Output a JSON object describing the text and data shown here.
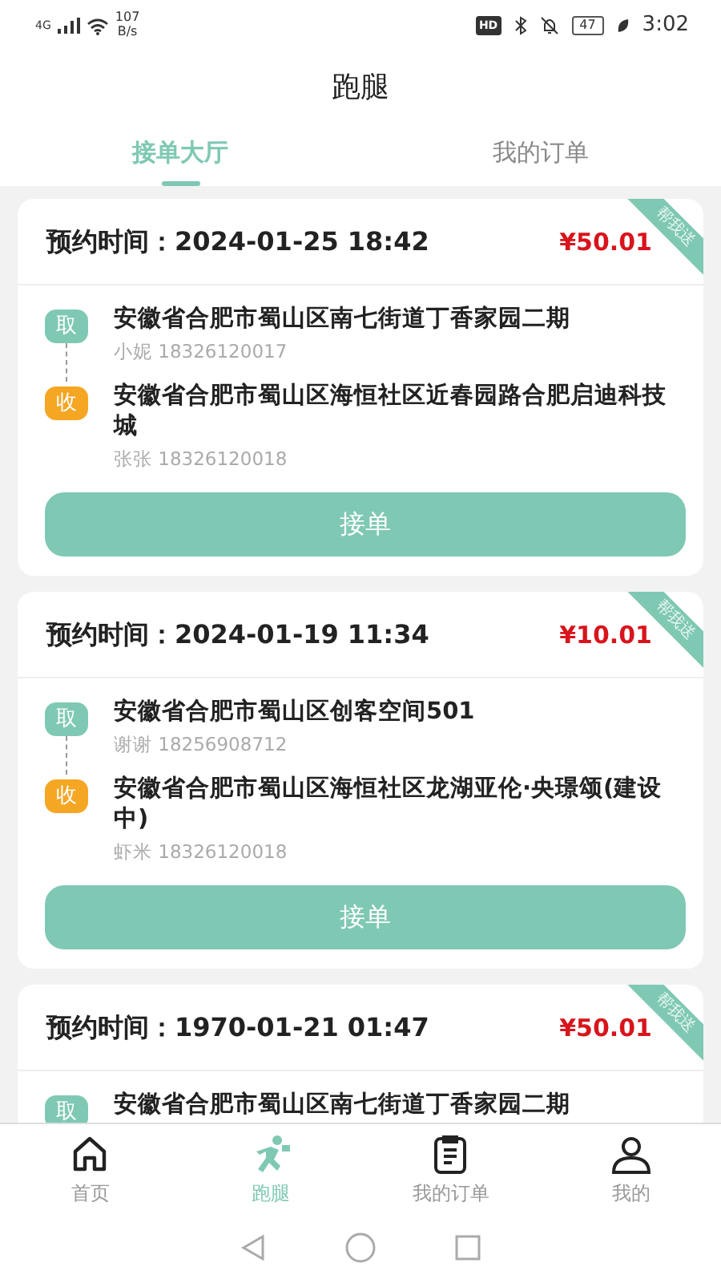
{
  "status_bar": {
    "network": "4G",
    "speed": "107",
    "speed_unit": "B/s",
    "hd": "HD",
    "battery": "47",
    "time": "3:02"
  },
  "title": "跑腿",
  "tabs": [
    {
      "label": "接单大厅",
      "selected": true
    },
    {
      "label": "我的订单",
      "selected": false
    }
  ],
  "orders": [
    {
      "time_label": "预约时间：",
      "time": "2024-01-25 18:42",
      "price": "¥50.01",
      "ribbon": "帮我送",
      "stops": [
        {
          "kind": "pickup",
          "badge": "取",
          "address": "安徽省合肥市蜀山区南七街道丁香家园二期",
          "contact": "小妮 18326120017"
        },
        {
          "kind": "dropoff",
          "badge": "收",
          "address": "安徽省合肥市蜀山区海恒社区近春园路合肥启迪科技城",
          "contact": "张张 18326120018"
        }
      ],
      "button": "接单"
    },
    {
      "time_label": "预约时间：",
      "time": "2024-01-19 11:34",
      "price": "¥10.01",
      "ribbon": "帮我送",
      "stops": [
        {
          "kind": "pickup",
          "badge": "取",
          "address": "安徽省合肥市蜀山区创客空间501",
          "contact": "谢谢 18256908712"
        },
        {
          "kind": "dropoff",
          "badge": "收",
          "address": "安徽省合肥市蜀山区海恒社区龙湖亚伦·央璟颂(建设中)",
          "contact": "虾米 18326120018"
        }
      ],
      "button": "接单"
    },
    {
      "time_label": "预约时间：",
      "time": "1970-01-21 01:47",
      "price": "¥50.01",
      "ribbon": "帮我送",
      "stops": [
        {
          "kind": "pickup",
          "badge": "取",
          "address": "安徽省合肥市蜀山区南七街道丁香家园二期"
        }
      ]
    }
  ],
  "bottom_nav": [
    {
      "kind": "home",
      "label": "首页",
      "selected": false
    },
    {
      "kind": "runner",
      "label": "跑腿",
      "selected": true
    },
    {
      "kind": "orders",
      "label": "我的订单",
      "selected": false
    },
    {
      "kind": "profile",
      "label": "我的",
      "selected": false
    }
  ]
}
